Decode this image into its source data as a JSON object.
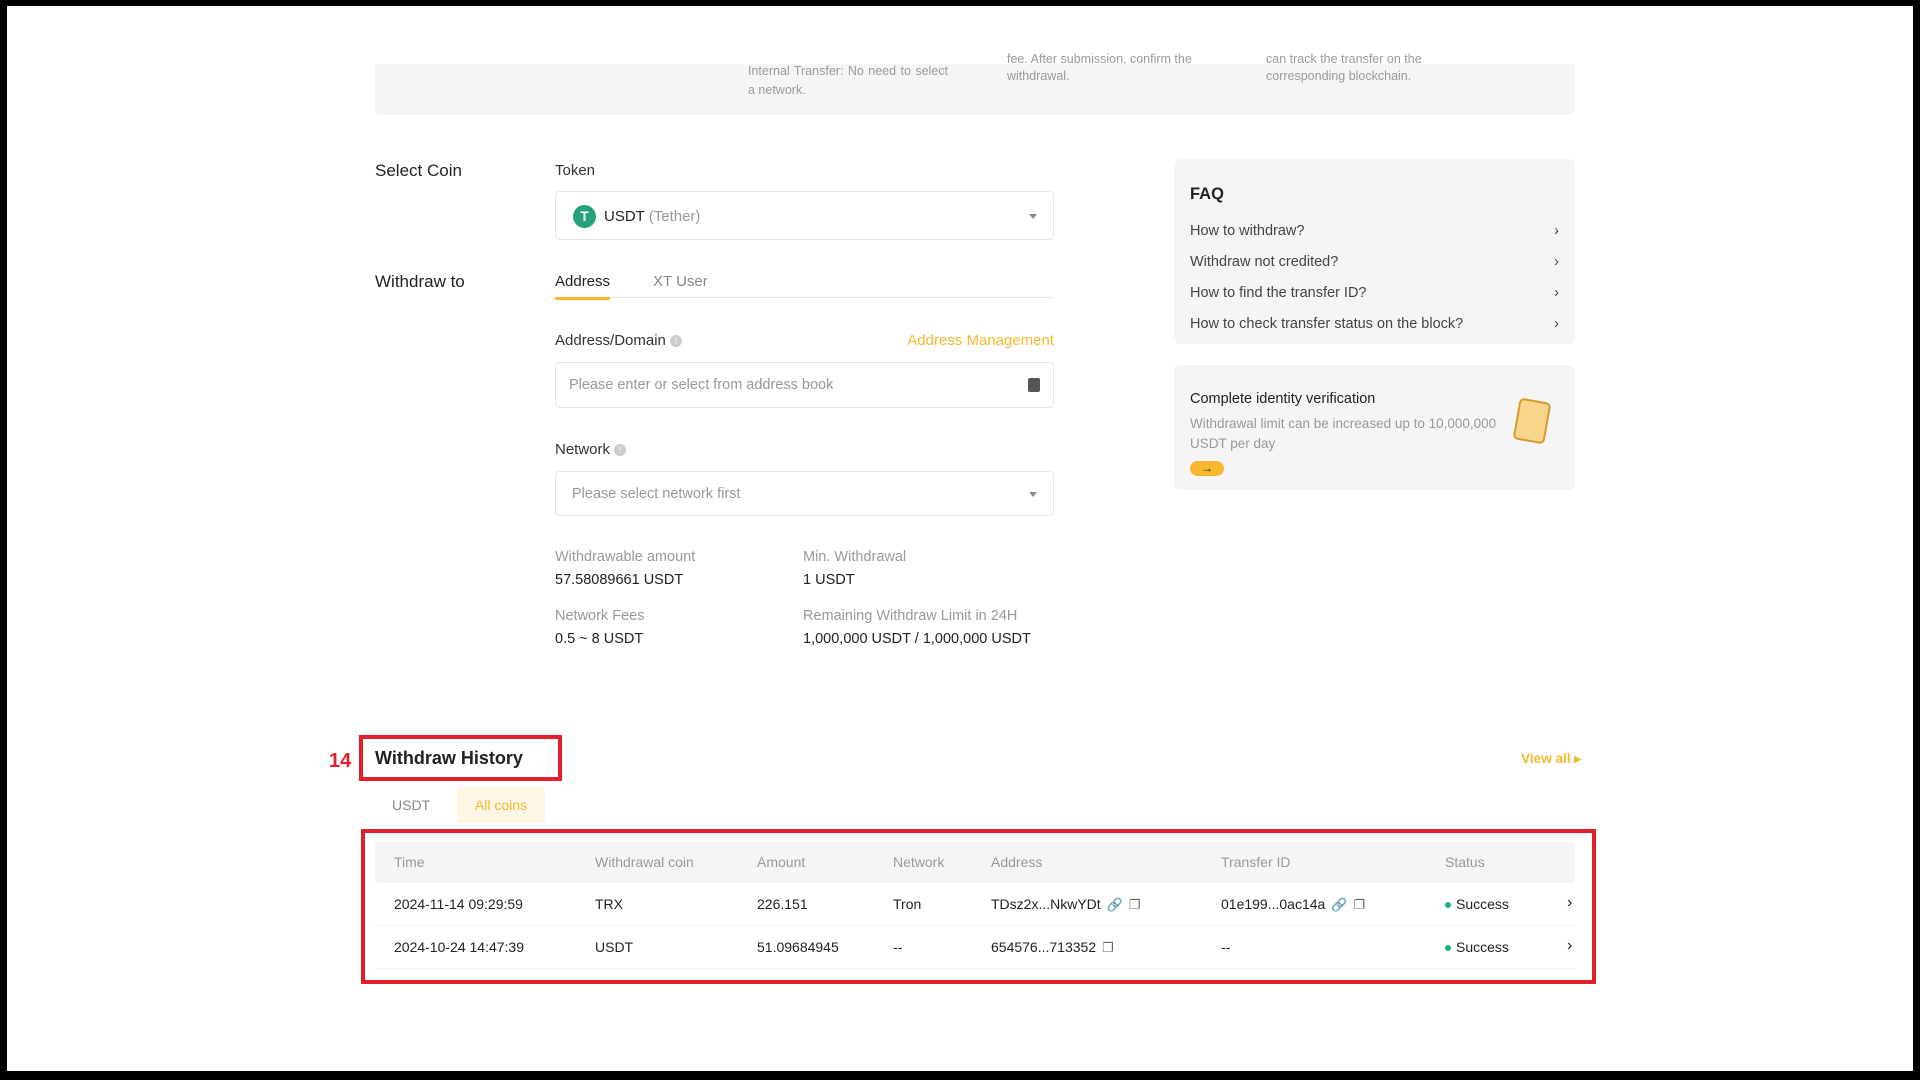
{
  "steps": {
    "col1": "Internal Transfer: No need to select a network.",
    "col2_cut": "fee. After submission, confirm the",
    "col2": "withdrawal.",
    "col3_cut": "can track the transfer on the",
    "col3": "corresponding blockchain."
  },
  "form": {
    "select_coin": "Select Coin",
    "token_label": "Token",
    "token_symbol": "USDT",
    "token_name": "(Tether)",
    "withdraw_to": "Withdraw to",
    "tabs": [
      "Address",
      "XT User"
    ],
    "address_label": "Address/Domain",
    "address_management": "Address Management",
    "address_placeholder": "Please enter or select from address book",
    "network_label": "Network",
    "network_placeholder": "Please select network first",
    "withdrawable_label": "Withdrawable amount",
    "withdrawable_value": "57.58089661 USDT",
    "min_label": "Min. Withdrawal",
    "min_value": "1 USDT",
    "fees_label": "Network Fees",
    "fees_value": "0.5 ~ 8 USDT",
    "limit_label": "Remaining Withdraw Limit in 24H",
    "limit_value": "1,000,000 USDT / 1,000,000 USDT"
  },
  "faq": {
    "title": "FAQ",
    "items": [
      "How to withdraw?",
      "Withdraw not credited?",
      "How to find the transfer ID?",
      "How to check transfer status on the block?"
    ]
  },
  "verify": {
    "title": "Complete identity verification",
    "desc": "Withdrawal limit can be increased up to 10,000,000 USDT per day"
  },
  "history": {
    "annotation": "14",
    "title": "Withdraw History",
    "view_all": "View all",
    "filters": [
      "USDT",
      "All coins"
    ],
    "columns": [
      "Time",
      "Withdrawal coin",
      "Amount",
      "Network",
      "Address",
      "Transfer ID",
      "Status"
    ],
    "rows": [
      {
        "time": "2024-11-14 09:29:59",
        "coin": "TRX",
        "amount": "226.151",
        "network": "Tron",
        "address": "TDsz2x...NkwYDt",
        "txid": "01e199...0ac14a",
        "status": "Success"
      },
      {
        "time": "2024-10-24 14:47:39",
        "coin": "USDT",
        "amount": "51.09684945",
        "network": "--",
        "address": "654576...713352",
        "txid": "--",
        "status": "Success"
      }
    ]
  },
  "colors": {
    "accent": "#f5b82e",
    "success": "#19b27a",
    "annotation": "#e0202a"
  }
}
